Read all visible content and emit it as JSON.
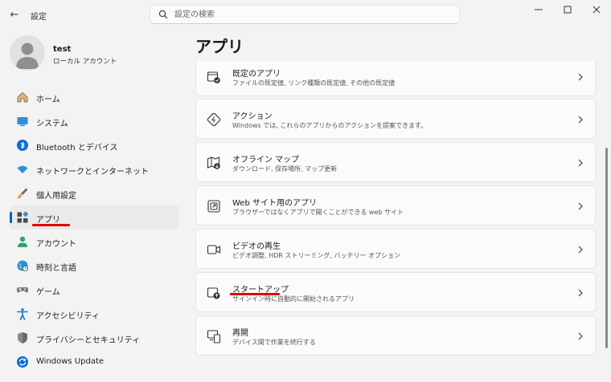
{
  "window": {
    "app_title": "設定",
    "back_glyph": "←",
    "search_placeholder": "設定の検索"
  },
  "profile": {
    "name": "test",
    "account_type": "ローカル アカウント"
  },
  "nav": [
    {
      "label": "ホーム",
      "icon": "home-icon"
    },
    {
      "label": "システム",
      "icon": "system-icon"
    },
    {
      "label": "Bluetooth とデバイス",
      "icon": "bluetooth-icon"
    },
    {
      "label": "ネットワークとインターネット",
      "icon": "wifi-icon"
    },
    {
      "label": "個人用設定",
      "icon": "brush-icon"
    },
    {
      "label": "アプリ",
      "icon": "apps-icon",
      "selected": true
    },
    {
      "label": "アカウント",
      "icon": "account-icon"
    },
    {
      "label": "時刻と言語",
      "icon": "globe-clock-icon"
    },
    {
      "label": "ゲーム",
      "icon": "gamepad-icon"
    },
    {
      "label": "アクセシビリティ",
      "icon": "accessibility-icon"
    },
    {
      "label": "プライバシーとセキュリティ",
      "icon": "shield-icon"
    },
    {
      "label": "Windows Update",
      "icon": "update-icon"
    }
  ],
  "page": {
    "title": "アプリ"
  },
  "cards": [
    {
      "title": "既定のアプリ",
      "desc": "ファイルの既定値, リンク種類の既定値, その他の既定値",
      "icon": "default-apps-icon"
    },
    {
      "title": "アクション",
      "desc": "Windows では, これらのアプリからのアクションを提案できます。",
      "icon": "actions-icon"
    },
    {
      "title": "オフライン マップ",
      "desc": "ダウンロード, 保存場所, マップ更新",
      "icon": "offline-map-icon"
    },
    {
      "title": "Web サイト用のアプリ",
      "desc": "ブラウザーではなくアプリで開くことができる web サイト",
      "icon": "web-apps-icon"
    },
    {
      "title": "ビデオの再生",
      "desc": "ビデオ調整, HDR ストリーミング, バッテリー オプション",
      "icon": "video-icon"
    },
    {
      "title": "スタートアップ",
      "desc": "サインイン時に自動的に開始されるアプリ",
      "icon": "startup-icon"
    },
    {
      "title": "再開",
      "desc": "デバイス間で作業を続行する",
      "icon": "resume-icon"
    }
  ],
  "colors": {
    "accent": "#005fb8",
    "highlight": "#e00000"
  }
}
